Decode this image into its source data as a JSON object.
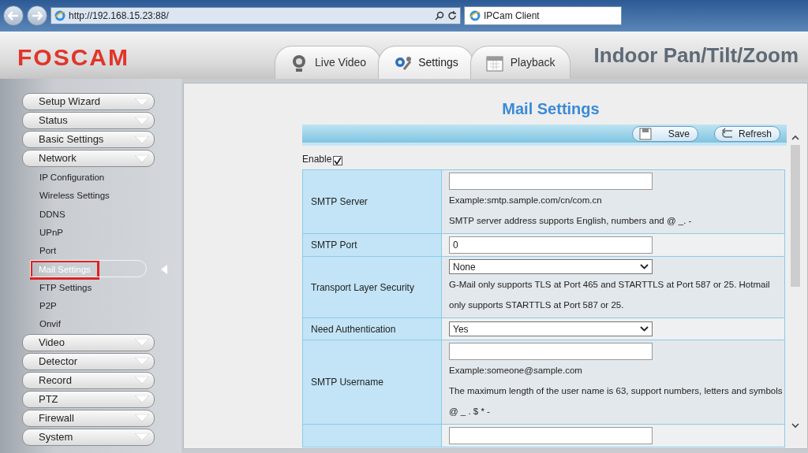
{
  "browser": {
    "address": "http://192.168.15.23:88/",
    "tab_title": "IPCam Client"
  },
  "header": {
    "logo": "FOSCAM",
    "product_title": "Indoor Pan/Tilt/Zoom",
    "tabs": [
      {
        "label": "Live Video",
        "kind": "camera",
        "selected": false
      },
      {
        "label": "Settings",
        "kind": "gears",
        "selected": true
      },
      {
        "label": "Playback",
        "kind": "calendar",
        "selected": false
      }
    ]
  },
  "sidebar": {
    "items": [
      {
        "label": "Setup Wizard",
        "kind": "group",
        "selected": false
      },
      {
        "label": "Status",
        "kind": "group",
        "selected": false
      },
      {
        "label": "Basic Settings",
        "kind": "group",
        "selected": false
      },
      {
        "label": "Network",
        "kind": "group",
        "selected": false
      },
      {
        "label": "IP Configuration",
        "kind": "sub",
        "selected": false
      },
      {
        "label": "Wireless Settings",
        "kind": "sub",
        "selected": false
      },
      {
        "label": "DDNS",
        "kind": "sub",
        "selected": false
      },
      {
        "label": "UPnP",
        "kind": "sub",
        "selected": false
      },
      {
        "label": "Port",
        "kind": "sub",
        "selected": false
      },
      {
        "label": "Mail Settings",
        "kind": "sub",
        "selected": true
      },
      {
        "label": "FTP Settings",
        "kind": "sub",
        "selected": false
      },
      {
        "label": "P2P",
        "kind": "sub",
        "selected": false
      },
      {
        "label": "Onvif",
        "kind": "sub",
        "selected": false
      },
      {
        "label": "Video",
        "kind": "group",
        "selected": false
      },
      {
        "label": "Detector",
        "kind": "group",
        "selected": false
      },
      {
        "label": "Record",
        "kind": "group",
        "selected": false
      },
      {
        "label": "PTZ",
        "kind": "group",
        "selected": false
      },
      {
        "label": "Firewall",
        "kind": "group",
        "selected": false
      },
      {
        "label": "System",
        "kind": "group",
        "selected": false
      }
    ]
  },
  "page_title": "Mail Settings",
  "toolbar": [
    {
      "label": "Save",
      "kind": "save"
    },
    {
      "label": "Refresh",
      "kind": "refresh"
    }
  ],
  "enable": {
    "label": "Enable",
    "checked": true
  },
  "rows": [
    {
      "label": "SMTP Server",
      "kind": "text",
      "notes": [
        "Example:smtp.sample.com/cn/com.cn",
        "SMTP server address supports English, numbers and @ _. -"
      ]
    },
    {
      "label": "SMTP Port",
      "kind": "text",
      "value": "0"
    },
    {
      "label": "Transport Layer Security",
      "kind": "select",
      "value": "None",
      "notes": [
        "G-Mail only supports TLS at Port 465 and STARTTLS at Port 587 or 25. Hotmail only supports STARTTLS at Port 587 or 25."
      ]
    },
    {
      "label": "Need Authentication",
      "kind": "select",
      "value": "Yes"
    },
    {
      "label": "SMTP Username",
      "kind": "text",
      "notes": [
        "Example:someone@sample.com",
        "The maximum length of the user name is 63, support numbers, letters and symbols @ _ . $ * -"
      ]
    },
    {
      "kind": "text"
    }
  ]
}
